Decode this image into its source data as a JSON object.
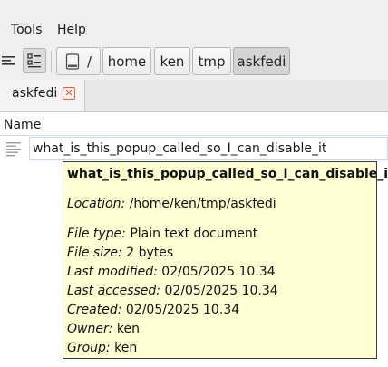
{
  "menubar": {
    "items": [
      {
        "label": "Tools"
      },
      {
        "label": "Help"
      }
    ]
  },
  "breadcrumb": [
    {
      "label": "/"
    },
    {
      "label": "home"
    },
    {
      "label": "ken"
    },
    {
      "label": "tmp"
    },
    {
      "label": "askfedi"
    }
  ],
  "tab": {
    "label": "askfedi",
    "close_glyph": "✕"
  },
  "list": {
    "column_name": "Name",
    "file_name": "what_is_this_popup_called_so_I_can_disable_it"
  },
  "tooltip": {
    "title": "what_is_this_popup_called_so_I_can_disable_it",
    "location_key": "Location:",
    "location_value": " /home/ken/tmp/askfedi",
    "file_type_key": "File type:",
    "file_type_value": " Plain text document",
    "file_size_key": "File size:",
    "file_size_value": " 2 bytes",
    "last_modified_key": "Last modified:",
    "last_modified_value": " 02/05/2025 10.34",
    "last_accessed_key": "Last accessed:",
    "last_accessed_value": " 02/05/2025 10.34",
    "created_key": "Created:",
    "created_value": " 02/05/2025 10.34",
    "owner_key": "Owner:",
    "owner_value": " ken",
    "group_key": "Group:",
    "group_value": " ken"
  },
  "icons": {
    "list_view": "list-view-icon",
    "detail_view": "detail-view-icon",
    "drive": "drive-icon",
    "text_file": "text-file-icon",
    "tab_close": "close-icon"
  },
  "colors": {
    "tooltip_bg": "#ffffd4",
    "tab_close_accent": "#e0503a",
    "selection_border": "#c6d8f0"
  }
}
